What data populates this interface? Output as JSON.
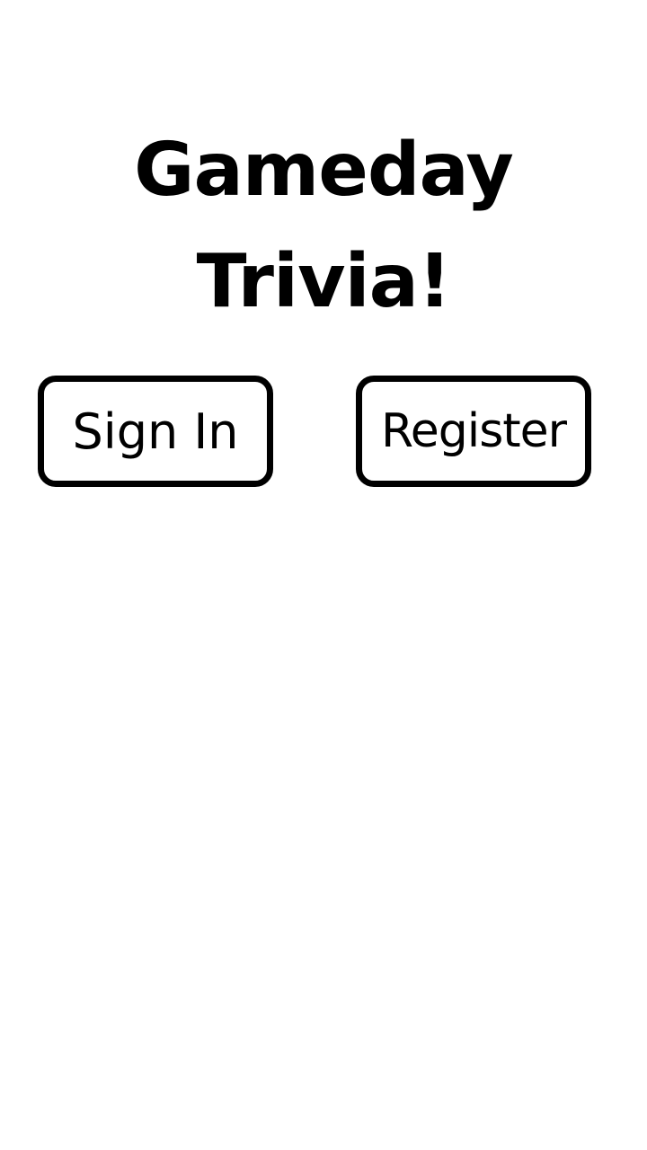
{
  "title": {
    "line1": "Gameday",
    "line2": "Trivia!"
  },
  "buttons": {
    "sign_in_label": "Sign In",
    "register_label": "Register"
  }
}
